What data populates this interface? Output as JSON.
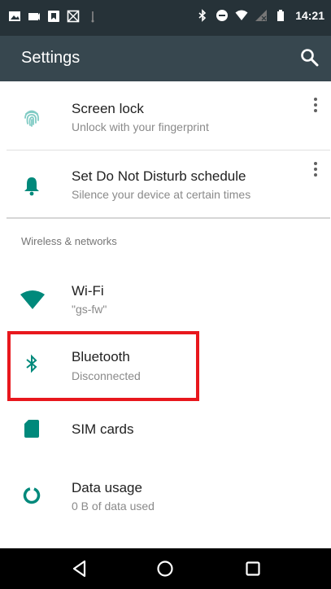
{
  "status_bar": {
    "time": "14:21",
    "left_icons": [
      "image-notification-icon",
      "message-notification-icon",
      "bookmark-notification-icon",
      "gallery-notification-icon",
      "usb-debug-icon"
    ],
    "right_icons": [
      "bluetooth-icon",
      "do-not-disturb-icon",
      "wifi-icon",
      "no-sim-icon",
      "battery-icon"
    ]
  },
  "app_bar": {
    "title": "Settings",
    "search_icon": "search-icon"
  },
  "items": {
    "screen_lock": {
      "title": "Screen lock",
      "subtitle": "Unlock with your fingerprint",
      "icon": "fingerprint-icon"
    },
    "dnd": {
      "title": "Set Do Not Disturb schedule",
      "subtitle": "Silence your device at certain times",
      "icon": "bell-icon"
    },
    "section_wireless": "Wireless & networks",
    "wifi": {
      "title": "Wi-Fi",
      "subtitle": "\"gs-fw\"",
      "icon": "wifi-icon"
    },
    "bluetooth": {
      "title": "Bluetooth",
      "subtitle": "Disconnected",
      "icon": "bluetooth-icon"
    },
    "sim": {
      "title": "SIM cards",
      "icon": "sim-card-icon"
    },
    "data_usage": {
      "title": "Data usage",
      "subtitle": "0 B of data used",
      "icon": "data-usage-icon"
    }
  },
  "nav_bar": {
    "buttons": [
      "back-icon",
      "home-icon",
      "recents-icon"
    ]
  },
  "colors": {
    "accent": "#00897b",
    "status_bar": "#263238",
    "app_bar": "#37474f",
    "highlight": "#e8171d"
  }
}
